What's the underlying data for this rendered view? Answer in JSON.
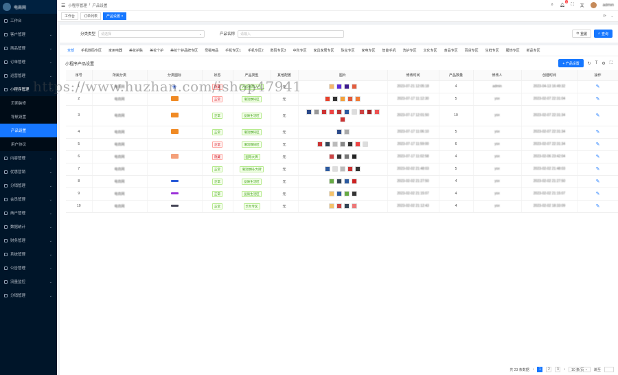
{
  "sidebar": {
    "app_name": "电商网",
    "items": [
      {
        "label": "工作台",
        "icon": "dashboard-icon",
        "has_children": false
      },
      {
        "label": "客户管理",
        "icon": "user-icon",
        "has_children": true
      },
      {
        "label": "商品管理",
        "icon": "box-icon",
        "has_children": true
      },
      {
        "label": "订单管理",
        "icon": "order-icon",
        "has_children": true
      },
      {
        "label": "运营管理",
        "icon": "operation-icon",
        "has_children": true
      },
      {
        "label": "小程序管理",
        "icon": "miniapp-icon",
        "has_children": true,
        "open": true,
        "children": [
          {
            "label": "页面装修",
            "active": false
          },
          {
            "label": "导航设置",
            "active": false
          },
          {
            "label": "产品设置",
            "active": true
          },
          {
            "label": "用户协议",
            "active": false
          }
        ]
      },
      {
        "label": "内容管理",
        "icon": "content-icon",
        "has_children": true
      },
      {
        "label": "优惠营销",
        "icon": "coupon-icon",
        "has_children": true
      },
      {
        "label": "分销管理",
        "icon": "share-icon",
        "has_children": true
      },
      {
        "label": "会员管理",
        "icon": "member-icon",
        "has_children": true
      },
      {
        "label": "商户管理",
        "icon": "shop-icon",
        "has_children": true
      },
      {
        "label": "数据统计",
        "icon": "chart-icon",
        "has_children": true
      },
      {
        "label": "财务管理",
        "icon": "finance-icon",
        "has_children": true
      },
      {
        "label": "系统管理",
        "icon": "system-icon",
        "has_children": true
      },
      {
        "label": "公告管理",
        "icon": "notice-icon",
        "has_children": true
      },
      {
        "label": "流量监控",
        "icon": "monitor-icon",
        "has_children": true
      },
      {
        "label": "分销管理",
        "icon": "network-icon",
        "has_children": true
      }
    ]
  },
  "topbar": {
    "breadcrumb": [
      "小程序管理",
      "产品设置"
    ],
    "notification_count": "1",
    "user_name": "admin"
  },
  "page_tabs": [
    {
      "label": "工作台",
      "active": false
    },
    {
      "label": "订单列表",
      "active": false
    },
    {
      "label": "产品设置",
      "active": true
    }
  ],
  "search": {
    "field1_label": "分类类型",
    "field1_placeholder": "请选择",
    "field2_label": "产品名称",
    "field2_placeholder": "请输入",
    "reset_label": "重置",
    "search_label": "查询"
  },
  "categories": [
    "全部",
    "手机数码专区",
    "家用电器",
    "美妆护肤",
    "美妆个护",
    "美妆个护品牌专区",
    "母婴用品",
    "手机专区1",
    "手机专区2",
    "数码专区3",
    "中秋专区",
    "家具家居专区",
    "珠宝专区",
    "家电专区",
    "智能手机",
    "洗护专区",
    "文化专区",
    "食品专区",
    "百货专区",
    "生鲜专区",
    "服饰专区",
    "新品专区"
  ],
  "table": {
    "title": "小程序产品设置",
    "add_label": "+ 产品设置",
    "columns": [
      "序号",
      "所属分类",
      "分类图标",
      "状态",
      "产品类型",
      "其他配置",
      "图片",
      "修改时间",
      "产品数量",
      "修改人",
      "创建时间",
      "操作"
    ],
    "rows": [
      {
        "no": "1",
        "category": "电商网",
        "logo": "icon-avatar",
        "status": "隐藏",
        "status_color": "red",
        "type": "为您推荐/人气",
        "other": "无",
        "thumbs": [
          "#f5b66b",
          "#5b2ad8",
          "#3d1b8e",
          "#e35d3f"
        ],
        "updated": "2023-07-21 12:05:18",
        "count": "4",
        "editor": "admin",
        "created": "2023-04-13 16:49:32"
      },
      {
        "no": "2",
        "category": "电商网",
        "logo": "#f08a24",
        "status": "正常",
        "status_color": "red",
        "type": "潮流数码区",
        "other": "无",
        "thumbs": [
          "#e8412c",
          "#333",
          "#f4a13a",
          "#e25b3a",
          "#f27a34"
        ],
        "updated": "2023-07-17 11:12:30",
        "count": "5",
        "editor": "ysx",
        "created": "2023-02-07 22:31:04"
      },
      {
        "no": "3",
        "category": "电商网",
        "logo": "#f08a24",
        "status": "正常",
        "status_color": "green",
        "type": "品质生活区",
        "other": "无",
        "thumbs": [
          "#2b4a8a",
          "#999",
          "#c33",
          "#e44",
          "#b33",
          "#2c5aa0",
          "#ddd",
          "#c44",
          "#a22",
          "#e55",
          "#c33"
        ],
        "updated": "2023-07-17 12:01:50",
        "count": "10",
        "editor": "ysx",
        "created": "2023-02-07 22:31:34"
      },
      {
        "no": "4",
        "category": "电商网",
        "logo": "#f08a24",
        "status": "正常",
        "status_color": "green",
        "type": "潮流数码区",
        "other": "无",
        "thumbs": [
          "#2b4a8a",
          "#aaa"
        ],
        "updated": "2023-07-17 11:06:10",
        "count": "5",
        "editor": "ysx",
        "created": "2023-02-07 22:31:34"
      },
      {
        "no": "5",
        "category": "电商网",
        "logo": "",
        "status": "正常",
        "status_color": "red",
        "type": "潮流数码区",
        "other": "无",
        "thumbs": [
          "#c33",
          "#345",
          "#bbb",
          "#888",
          "#333",
          "#e44",
          "#ddd"
        ],
        "updated": "2023-07-17 11:59:00",
        "count": "6",
        "editor": "ysx",
        "created": "2023-02-07 22:31:34"
      },
      {
        "no": "6",
        "category": "电商网",
        "logo": "#f4a07a",
        "status": "隐藏",
        "status_color": "red",
        "type": "国际大牌",
        "other": "无",
        "thumbs": [
          "#c44",
          "#333",
          "#777",
          "#222"
        ],
        "updated": "2023-07-17 11:02:58",
        "count": "4",
        "editor": "ysx",
        "created": "2023-02-06 23:42:04"
      },
      {
        "no": "7",
        "category": "电商网",
        "logo": "",
        "status": "正常",
        "status_color": "green",
        "type": "潮流数码/大牌",
        "other": "无",
        "thumbs": [
          "#2c5aa0",
          "#ddd",
          "#bbb",
          "#c33",
          "#333"
        ],
        "updated": "2023-02-02 21:48:03",
        "count": "5",
        "editor": "ysx",
        "created": "2023-02-02 21:48:03"
      },
      {
        "no": "8",
        "category": "电商网",
        "logo": "#2a5bd8",
        "status": "正常",
        "status_color": "green",
        "type": "品质生活区",
        "other": "无",
        "thumbs": [
          "#6a4",
          "#345",
          "#2c5aa0",
          "#c22"
        ],
        "updated": "2023-02-02 21:27:50",
        "count": "4",
        "editor": "ysx",
        "created": "2023-02-02 21:27:50"
      },
      {
        "no": "9",
        "category": "电商网",
        "logo": "#9b30d8",
        "status": "正常",
        "status_color": "green",
        "type": "品质生活区",
        "other": "无",
        "thumbs": [
          "#f4c26b",
          "#2c5aa0",
          "#6a4",
          "#333"
        ],
        "updated": "2023-02-02 21:15:07",
        "count": "4",
        "editor": "ysx",
        "created": "2023-02-02 21:15:07"
      },
      {
        "no": "10",
        "category": "电商网",
        "logo": "#445",
        "status": "正常",
        "status_color": "green",
        "type": "华为专区",
        "other": "无",
        "thumbs": [
          "#f4c26b",
          "#c44",
          "#345",
          "#e77"
        ],
        "updated": "2023-02-02 21:12:43",
        "count": "4",
        "editor": "ysx",
        "created": "2023-02-02 18:33:09"
      }
    ]
  },
  "pagination": {
    "total_text": "共 23 条数据",
    "pages": [
      "1",
      "2",
      "3"
    ],
    "current": "1",
    "page_size": "10 条/页",
    "goto_label": "跳至"
  },
  "watermark": "https://www.huzhan.com/ishop47941",
  "colors": {
    "primary": "#1677ff",
    "sidebar_bg": "#001529",
    "tag_green": "#389e0d",
    "tag_red": "#cf1322"
  }
}
